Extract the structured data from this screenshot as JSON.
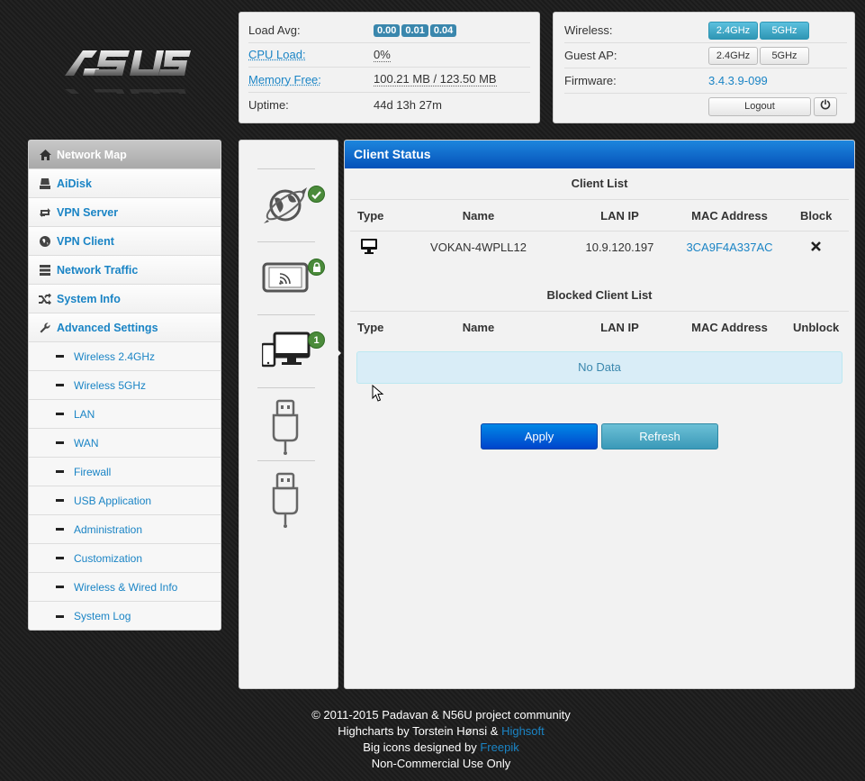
{
  "logo": {
    "text": "/ISUS"
  },
  "status": {
    "load_avg_label": "Load Avg:",
    "load_avg": [
      "0.00",
      "0.01",
      "0.04"
    ],
    "cpu_label": "CPU Load:",
    "cpu_value": "0%",
    "memory_label": "Memory Free:",
    "memory_value": "100.21 MB / 123.50 MB",
    "uptime_label": "Uptime:",
    "uptime_value": "44d 13h 27m"
  },
  "wireless": {
    "wireless_label": "Wireless:",
    "wireless_24": "2.4GHz",
    "wireless_5": "5GHz",
    "guest_label": "Guest AP:",
    "guest_24": "2.4GHz",
    "guest_5": "5GHz",
    "firmware_label": "Firmware:",
    "firmware_value": "3.4.3.9-099",
    "logout_label": "Logout"
  },
  "nav": {
    "items": [
      {
        "label": "Network Map",
        "icon": "home-icon"
      },
      {
        "label": "AiDisk",
        "icon": "hdd-icon"
      },
      {
        "label": "VPN Server",
        "icon": "retweet-icon"
      },
      {
        "label": "VPN Client",
        "icon": "globe-icon"
      },
      {
        "label": "Network Traffic",
        "icon": "tasks-icon"
      },
      {
        "label": "System Info",
        "icon": "random-icon"
      },
      {
        "label": "Advanced Settings",
        "icon": "wrench-icon"
      }
    ],
    "sub": [
      "Wireless 2.4GHz",
      "Wireless 5GHz",
      "LAN",
      "WAN",
      "Firewall",
      "USB Application",
      "Administration",
      "Customization",
      "Wireless & Wired Info",
      "System Log"
    ]
  },
  "icons": {
    "clients_count": "1"
  },
  "client": {
    "title": "Client Status",
    "client_list_title": "Client List",
    "headers": {
      "type": "Type",
      "name": "Name",
      "ip": "LAN IP",
      "mac": "MAC Address",
      "block": "Block",
      "unblock": "Unblock"
    },
    "rows": [
      {
        "name": "VOKAN-4WPLL12",
        "ip": "10.9.120.197",
        "mac": "3CA9F4A337AC"
      }
    ],
    "blocked_title": "Blocked Client List",
    "no_data": "No Data",
    "apply": "Apply",
    "refresh": "Refresh"
  },
  "footer": {
    "line1": "© 2011-2015 Padavan & N56U project community",
    "line2_prefix": "Highcharts by Torstein Hønsi & ",
    "line2_link": "Highsoft",
    "line3_prefix": "Big icons designed by ",
    "line3_link": "Freepik",
    "line4": "Non-Commercial Use Only"
  },
  "colors": {
    "accent_blue": "#1a84c5",
    "header_blue": "#0551b9",
    "badge_green": "#4b8b3b",
    "info_badge": "#3a87ad"
  }
}
